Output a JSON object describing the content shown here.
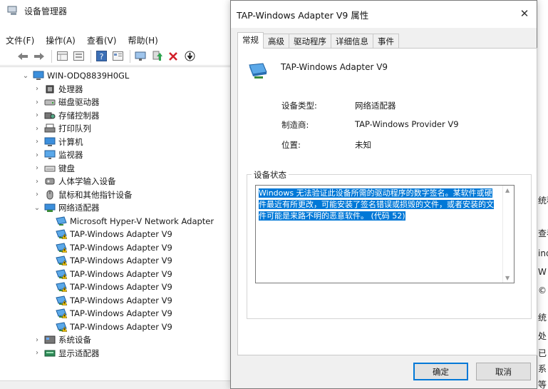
{
  "device_manager": {
    "title": "设备管理器",
    "menu": [
      "文件(F)",
      "操作(A)",
      "查看(V)",
      "帮助(H)"
    ],
    "toolbar_icons": [
      "back-arrow-icon",
      "forward-arrow-icon",
      "properties-grid-icon",
      "show-hidden-icon",
      "help-icon",
      "view-icon",
      "monitor-icon",
      "update-driver-icon",
      "uninstall-x-icon",
      "scan-hardware-icon"
    ],
    "tree": {
      "root": "WIN-ODQ8839H0GL",
      "categories": [
        {
          "label": "处理器",
          "icon": "cpu-icon"
        },
        {
          "label": "磁盘驱动器",
          "icon": "disk-icon"
        },
        {
          "label": "存储控制器",
          "icon": "storage-icon"
        },
        {
          "label": "打印队列",
          "icon": "printer-icon"
        },
        {
          "label": "计算机",
          "icon": "computer-icon"
        },
        {
          "label": "监视器",
          "icon": "monitor-icon"
        },
        {
          "label": "键盘",
          "icon": "keyboard-icon"
        },
        {
          "label": "人体学输入设备",
          "icon": "hid-icon"
        },
        {
          "label": "鼠标和其他指针设备",
          "icon": "mouse-icon"
        },
        {
          "label": "网络适配器",
          "icon": "network-icon",
          "expanded": true,
          "children": [
            {
              "label": "Microsoft Hyper-V Network Adapter",
              "warning": false
            },
            {
              "label": "TAP-Windows Adapter V9",
              "warning": true
            },
            {
              "label": "TAP-Windows Adapter V9",
              "warning": true
            },
            {
              "label": "TAP-Windows Adapter V9",
              "warning": true
            },
            {
              "label": "TAP-Windows Adapter V9",
              "warning": true
            },
            {
              "label": "TAP-Windows Adapter V9",
              "warning": true
            },
            {
              "label": "TAP-Windows Adapter V9",
              "warning": true
            },
            {
              "label": "TAP-Windows Adapter V9",
              "warning": true
            },
            {
              "label": "TAP-Windows Adapter V9",
              "warning": true
            }
          ]
        },
        {
          "label": "系统设备",
          "icon": "system-icon"
        },
        {
          "label": "显示适配器",
          "icon": "display-adapter-icon"
        }
      ]
    }
  },
  "dialog": {
    "title": "TAP-Windows Adapter V9 属性",
    "tabs": [
      "常规",
      "高级",
      "驱动程序",
      "详细信息",
      "事件"
    ],
    "active_tab": "常规",
    "device_name": "TAP-Windows Adapter V9",
    "properties": [
      {
        "label": "设备类型:",
        "value": "网络适配器"
      },
      {
        "label": "制造商:",
        "value": "TAP-Windows Provider V9"
      },
      {
        "label": "位置:",
        "value": "未知"
      }
    ],
    "status_group_label": "设备状态",
    "status_lines": [
      "Windows 无法验证此设备所需的驱动程序的数字签名。某软件或硬",
      "件最近有所更改，可能安装了签名错误或损毁的文件，或者安装的文",
      "件可能是来路不明的恶意软件。 (代码 52)"
    ],
    "ok_label": "确定",
    "cancel_label": "取消"
  },
  "background_window": {
    "fragments": [
      "统积",
      "查看",
      "ind",
      "W",
      "©",
      "统",
      "处",
      "已",
      "系",
      "等"
    ]
  },
  "colors": {
    "selection": "#0078d7",
    "warning": "#f3c400",
    "network_icon": "#2e7fd1"
  }
}
